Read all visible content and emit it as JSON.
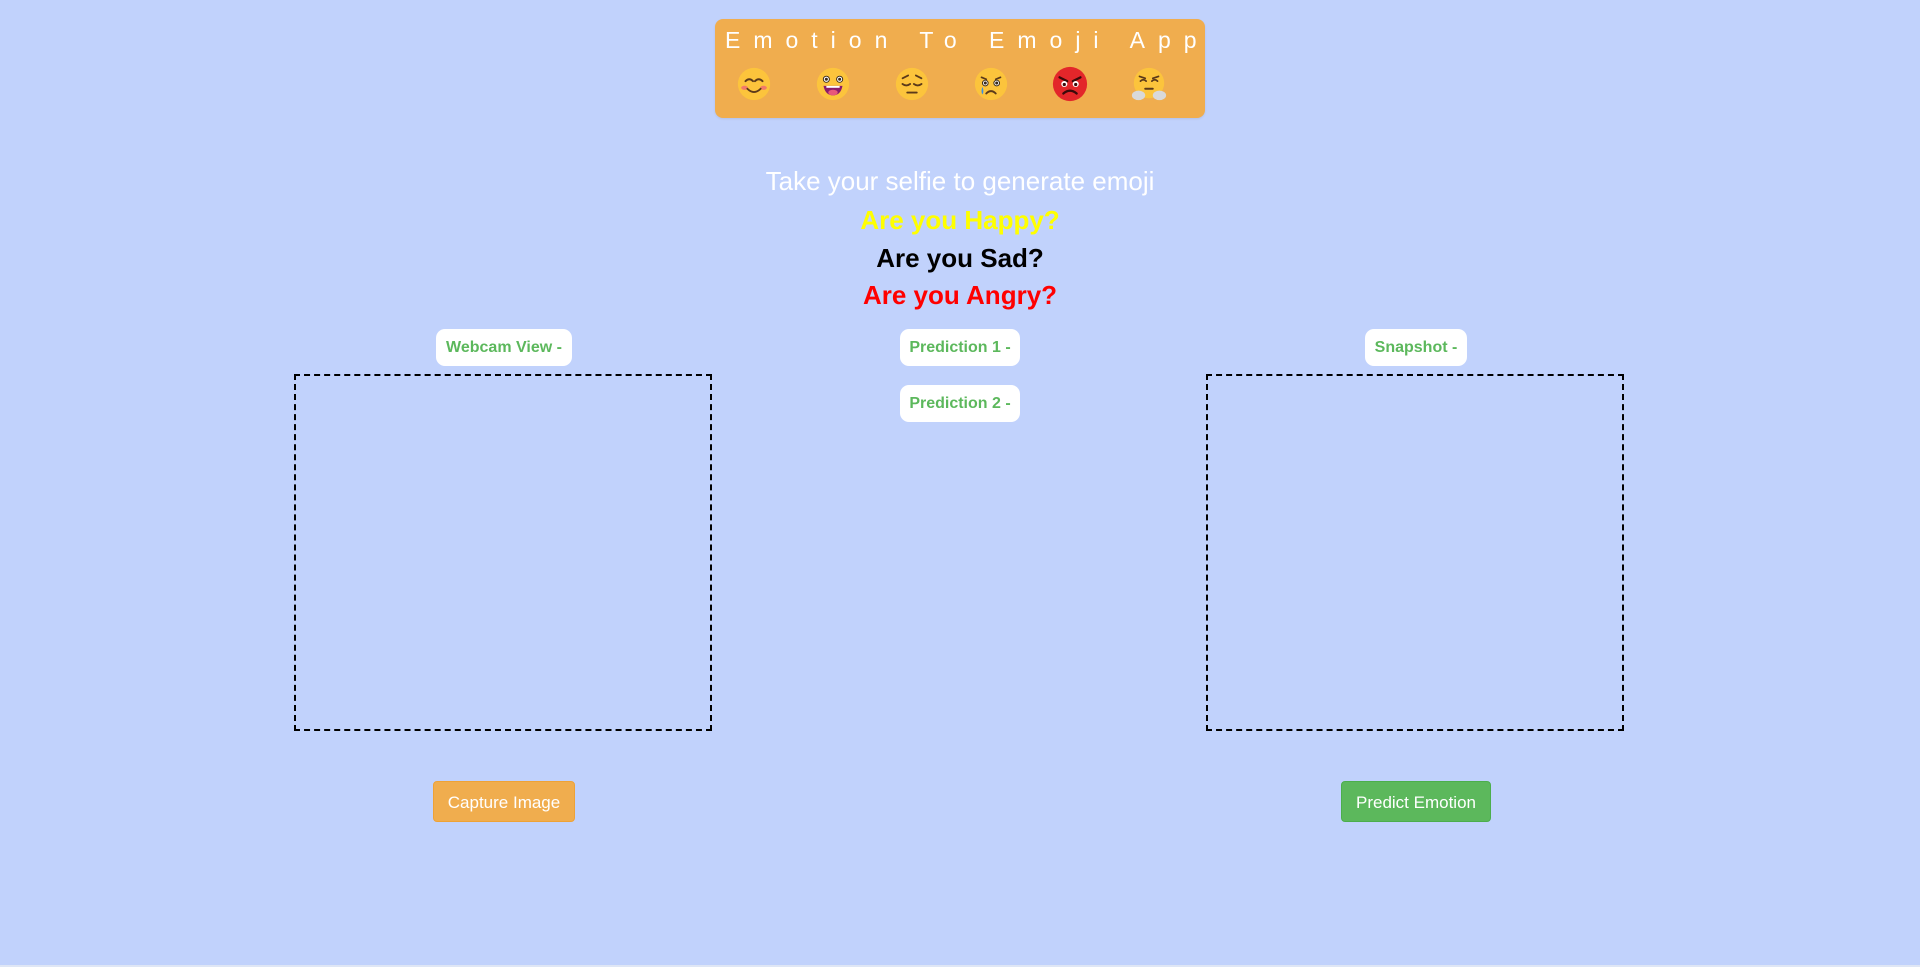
{
  "header": {
    "title": "Emotion To Emoji App",
    "emojis": [
      "smiling-face-icon",
      "grinning-tongue-face-icon",
      "pensive-face-icon",
      "crying-face-icon",
      "angry-face-icon",
      "face-with-steam-icon"
    ]
  },
  "prompt": {
    "subtitle": "Take your selfie to generate emoji",
    "questions": {
      "happy": "Are you Happy?",
      "sad": "Are you Sad?",
      "angry": "Are you Angry?"
    }
  },
  "labels": {
    "webcam": "Webcam View -",
    "prediction1": "Prediction 1 -",
    "prediction2": "Prediction 2 -",
    "snapshot": "Snapshot -"
  },
  "buttons": {
    "capture": "Capture Image",
    "predict": "Predict Emotion"
  },
  "colors": {
    "background": "#c1d2fc",
    "header": "#f0ad4e",
    "happy": "#ffff00",
    "sad": "#000000",
    "angry": "#ff0000",
    "label_text": "#5cb85c",
    "capture_button": "#f0ad4e",
    "predict_button": "#5cb85c"
  }
}
